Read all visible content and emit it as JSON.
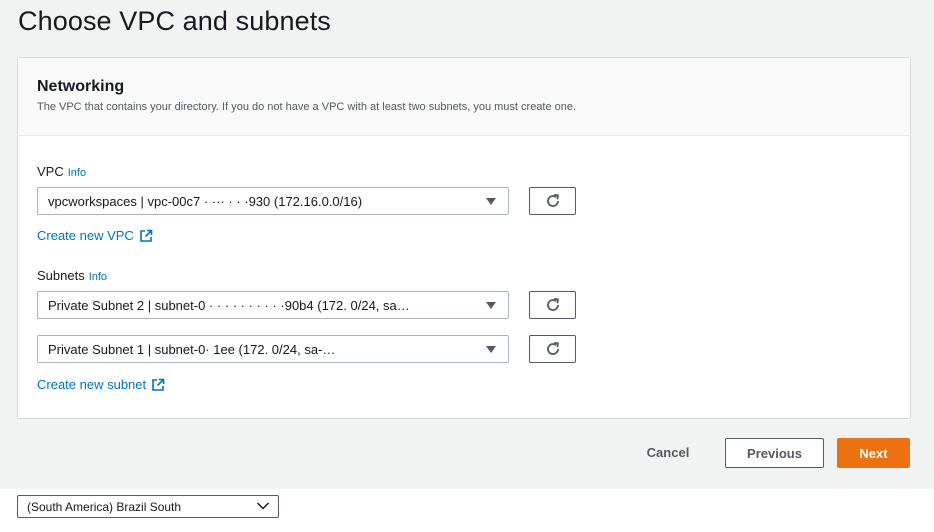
{
  "page": {
    "title": "Choose VPC and subnets"
  },
  "networking": {
    "title": "Networking",
    "description": "The VPC that contains your directory. If you do not have a VPC with at least two subnets, you must create one.",
    "vpc": {
      "label": "VPC",
      "info": "Info",
      "selected": "vpcworkspaces | vpc-00c7   ·  ··· ·  ·  ·930 (172.16.0.0/16)",
      "create_link": "Create new VPC"
    },
    "subnets": {
      "label": "Subnets",
      "info": "Info",
      "subnet_1": "Private Subnet 2 | subnet-0 · · · · · · · · · ·90b4 (172.        0/24, sa…",
      "subnet_2": "Private Subnet 1 | subnet-0·                              1ee (172.       0/24, sa-…",
      "create_link": "Create new subnet"
    }
  },
  "actions": {
    "cancel": "Cancel",
    "previous": "Previous",
    "next": "Next"
  },
  "footer": {
    "region": "(South America) Brazil South"
  },
  "icons": {
    "refresh": "refresh-icon",
    "external_link": "external-link-icon",
    "dropdown": "caret-down-icon"
  },
  "colors": {
    "link": "#0073bb",
    "primary_button": "#ec7211",
    "background": "#f2f3f3"
  }
}
